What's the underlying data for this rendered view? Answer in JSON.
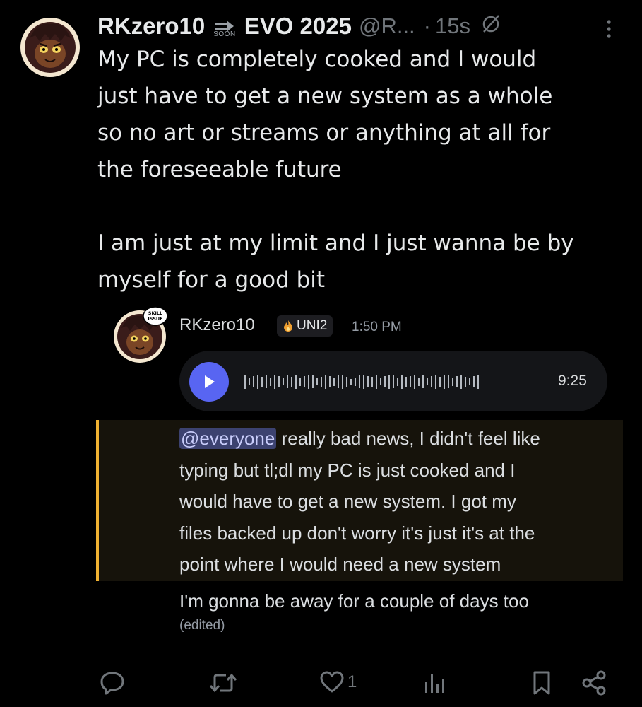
{
  "header": {
    "display_name": "RKzero10",
    "soon_label": "SOON",
    "event_name": "EVO 2025",
    "handle": "@R...",
    "separator": "·",
    "timestamp": "15s"
  },
  "tweet": {
    "text": "My PC is completely cooked and I would\njust have to get a new system as a whole\nso no art or streams or anything at all for\nthe foreseeable future\n\nI am just at my limit and I just wanna be by\nmyself for a good bit"
  },
  "embed": {
    "avatar_badge_text": "SKILL ISSUE",
    "username": "RKzero10",
    "tag": "UNI2",
    "time": "1:50 PM",
    "voice_duration": "9:25",
    "mention": "@everyone",
    "message_line1_rest": " really bad news, I didn't feel like",
    "message_rest": "typing but tl;dl my PC is just cooked and I\nwould have to get a new system. I got my\nfiles backed up don't worry it's just it's at the\npoint where I would need a new system",
    "message2": "I'm gonna be away for a couple of days too",
    "edited": "(edited)"
  },
  "actions": {
    "like_count": "1"
  },
  "colors": {
    "background": "#000000",
    "text": "#e7e9ea",
    "muted": "#71767b",
    "discord_blurple": "#5865f2",
    "mention_highlight": "#f0b232"
  },
  "icons": [
    "avatar",
    "arrow-right-icon",
    "unavailable-icon",
    "more-icon",
    "play-icon",
    "fire-icon",
    "reply-icon",
    "retweet-icon",
    "like-icon",
    "views-icon",
    "bookmark-icon",
    "share-icon"
  ]
}
